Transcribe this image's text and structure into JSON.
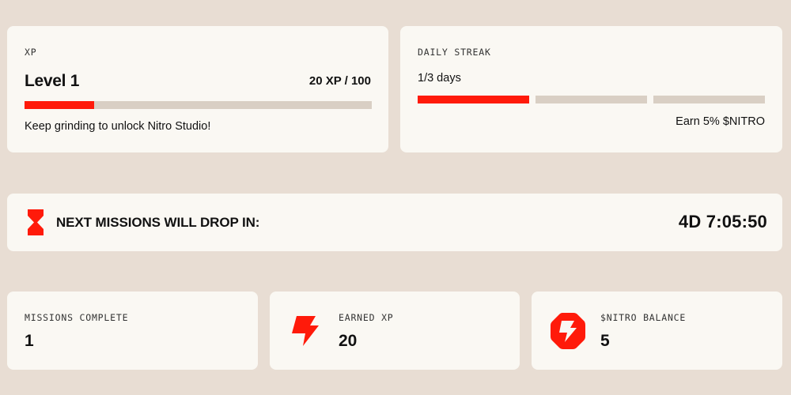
{
  "xp": {
    "label": "XP",
    "level": "Level 1",
    "amount": "20 XP / 100",
    "progress": 0.2,
    "message": "Keep grinding to unlock Nitro Studio!"
  },
  "streak": {
    "label": "DAILY STREAK",
    "days": "1/3 days",
    "completed": 1,
    "total": 3,
    "reward": "Earn 5% $NITRO"
  },
  "drop": {
    "icon": "hourglass-icon",
    "label": "NEXT MISSIONS WILL DROP IN:",
    "timer": "4D 7:05:50"
  },
  "stats": {
    "missions": {
      "label": "MISSIONS COMPLETE",
      "value": "1"
    },
    "earned_xp": {
      "label": "EARNED XP",
      "value": "20",
      "icon": "lightning-bolt-icon"
    },
    "nitro": {
      "label": "$NITRO BALANCE",
      "value": "5",
      "icon": "nitro-token-icon"
    }
  },
  "colors": {
    "accent": "#ff1a0a",
    "track": "#d9cfc4",
    "card": "#faf8f3",
    "background": "#e8ddd3"
  }
}
